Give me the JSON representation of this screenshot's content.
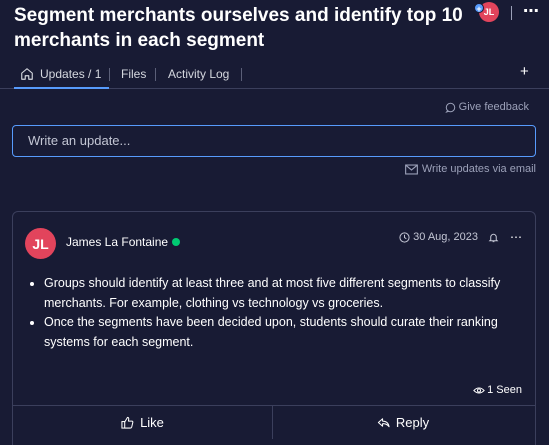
{
  "header": {
    "title": "Segment merchants ourselves and identify top 10 merchants in each segment",
    "avatar_initials": "JL",
    "more_icon": "ellipsis-icon"
  },
  "tabs": [
    {
      "label": "Updates / 1",
      "icon": "home-icon",
      "active": true
    },
    {
      "label": "Files"
    },
    {
      "label": "Activity Log"
    }
  ],
  "tabs_add_label": "+",
  "feedback": {
    "label": "Give feedback",
    "icon": "chat-bubble-icon"
  },
  "composer": {
    "placeholder": "Write an update...",
    "email_label": "Write updates via email"
  },
  "post": {
    "avatar_initials": "JL",
    "author": "James La Fontaine",
    "date": "30 Aug, 2023",
    "bullets": [
      "Groups should identify at least three and at most five different segments to classify merchants. For example, clothing vs technology vs groceries.",
      "Once the segments have been decided upon, students should curate their ranking systems for each segment."
    ],
    "seen_label": "1 Seen",
    "like_label": "Like",
    "reply_label": "Reply"
  },
  "colors": {
    "background": "#181b34",
    "accent": "#579bfc",
    "avatar": "#e2445c",
    "online": "#00ca72"
  }
}
